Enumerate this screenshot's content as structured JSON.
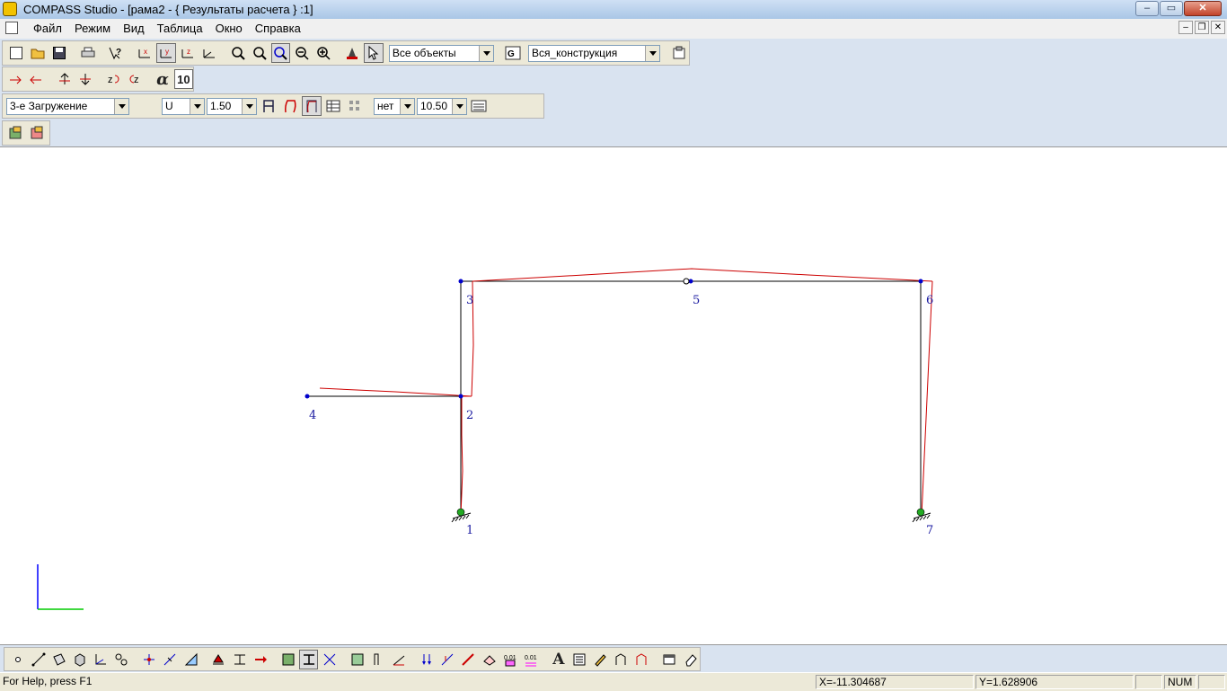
{
  "window": {
    "title": "COMPASS  Studio - [рама2 - { Результаты расчета } :1]",
    "minimize": "–",
    "maximize": "▭",
    "close": "✕"
  },
  "menu": {
    "items": [
      "Файл",
      "Режим",
      "Вид",
      "Таблица",
      "Окно",
      "Справка"
    ],
    "mdi": {
      "minimize": "–",
      "restore": "❐",
      "close": "✕"
    }
  },
  "toolbar1": {
    "objects_combo": "Все объекты",
    "construction_combo": "Вся_конструкция"
  },
  "toolbar2": {
    "alpha_label": "α",
    "ten_label": "10"
  },
  "toolbar3": {
    "load_case_combo": "3-е Загружение",
    "component_combo": "U",
    "scale_combo": "1.50",
    "labels_combo": "нет",
    "font_size_combo": "10.50"
  },
  "model": {
    "nodes": [
      {
        "id": "1"
      },
      {
        "id": "2"
      },
      {
        "id": "3"
      },
      {
        "id": "4"
      },
      {
        "id": "5"
      },
      {
        "id": "6"
      },
      {
        "id": "7"
      }
    ],
    "colors": {
      "frame": "#000000",
      "deformed": "#cc0000",
      "node": "#0000cc",
      "label": "#1a1aa0",
      "support_green": "#22aa22",
      "axis_y": "#0000ff",
      "axis_x": "#00cc00"
    }
  },
  "status": {
    "help": "For Help, press F1",
    "x_coord": "X=-11.304687",
    "y_coord": "Y=1.628906",
    "num": "NUM"
  }
}
